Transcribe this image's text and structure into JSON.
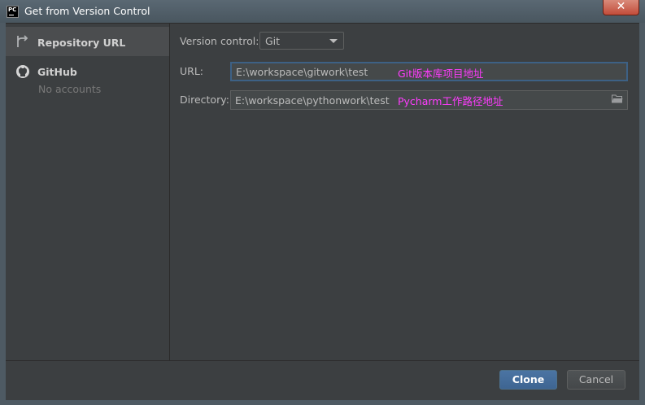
{
  "window": {
    "title": "Get from Version Control",
    "app_icon_text": "PC",
    "close_glyph": "✕"
  },
  "sidebar": {
    "items": [
      {
        "label": "Repository URL",
        "icon": "repository-url-icon",
        "selected": true
      },
      {
        "label": "GitHub",
        "sublabel": "No accounts",
        "icon": "github-icon",
        "selected": false
      }
    ]
  },
  "form": {
    "version_control": {
      "label": "Version control:",
      "value": "Git"
    },
    "url": {
      "label": "URL:",
      "value": "E:\\workspace\\gitwork\\test",
      "annotation": "Git版本库项目地址"
    },
    "directory": {
      "label": "Directory:",
      "value": "E:\\workspace\\pythonwork\\test",
      "annotation": "Pycharm工作路径地址"
    }
  },
  "buttons": {
    "clone": "Clone",
    "cancel": "Cancel"
  },
  "colors": {
    "background": "#3c3f41",
    "selected_item": "#4b4d4f",
    "primary_button": "#4a6f9a",
    "annotation": "#ff3cff",
    "focus_border": "#3d6185"
  }
}
